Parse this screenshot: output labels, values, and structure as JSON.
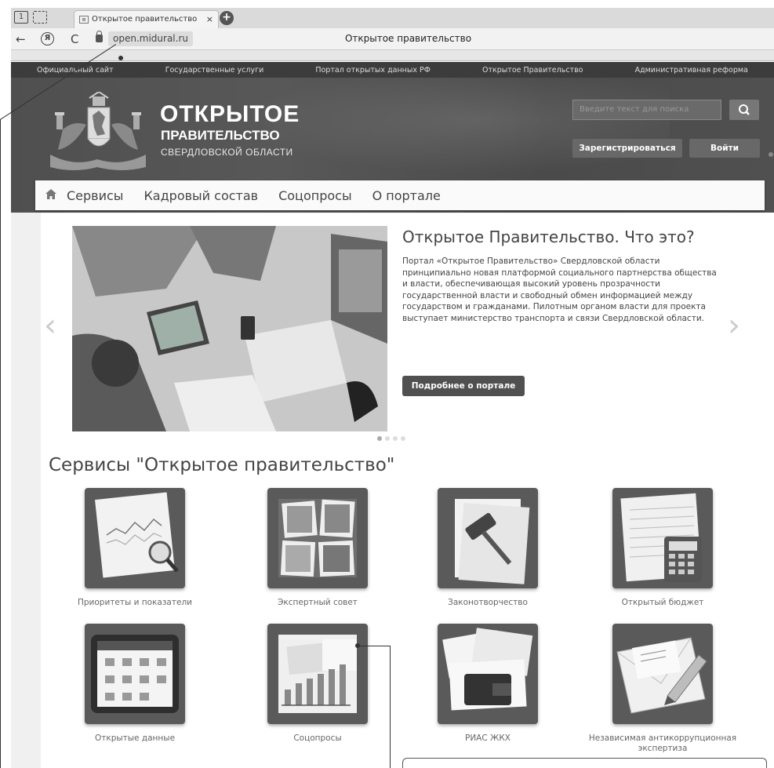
{
  "browser": {
    "tab_title": "Открытое правительство",
    "tab_close": "×",
    "new_tab": "+",
    "url": "open.midural.ru",
    "page_title": "Открытое правительство",
    "back_icon": "←",
    "reload_icon": "C",
    "yandex_icon": "Я"
  },
  "toplinks": [
    "Официальный сайт",
    "Государственные услуги",
    "Портал открытых данных РФ",
    "Открытое Правительство",
    "Административная реформа"
  ],
  "header": {
    "brand_line1": "ОТКРЫТОЕ",
    "brand_line2": "ПРАВИТЕЛЬСТВО",
    "brand_line3": "СВЕРДЛОВСКОЙ ОБЛАСТИ",
    "search_placeholder": "Введите текст для поиска",
    "register_label": "Зарегистрироваться",
    "login_label": "Войти"
  },
  "menu": {
    "items": [
      "Сервисы",
      "Кадровый состав",
      "Соцопросы",
      "О портале"
    ]
  },
  "hero": {
    "title": "Открытое Правительство. Что это?",
    "text": "Портал «Открытое Правительство» Свердловской области принципиально новая платформой социального партнерства общества и власти, обеспечивающая высокий уровень прозрачности государственной власти и свободный обмен информацией между государством и гражданами. Пилотным органом власти для проекта выступает министерство транспорта и связи Свердловской области.",
    "button": "Подробнее о портале",
    "prev": "‹",
    "next": "›"
  },
  "services": {
    "title": "Сервисы \"Открытое правительство\"",
    "items": [
      "Приоритеты и показатели",
      "Экспертный совет",
      "Законотворчество",
      "Открытый бюджет",
      "Открытые данные",
      "Соцопросы",
      "РИАС ЖКХ",
      "Независимая антикоррупционная экспертиза"
    ]
  }
}
